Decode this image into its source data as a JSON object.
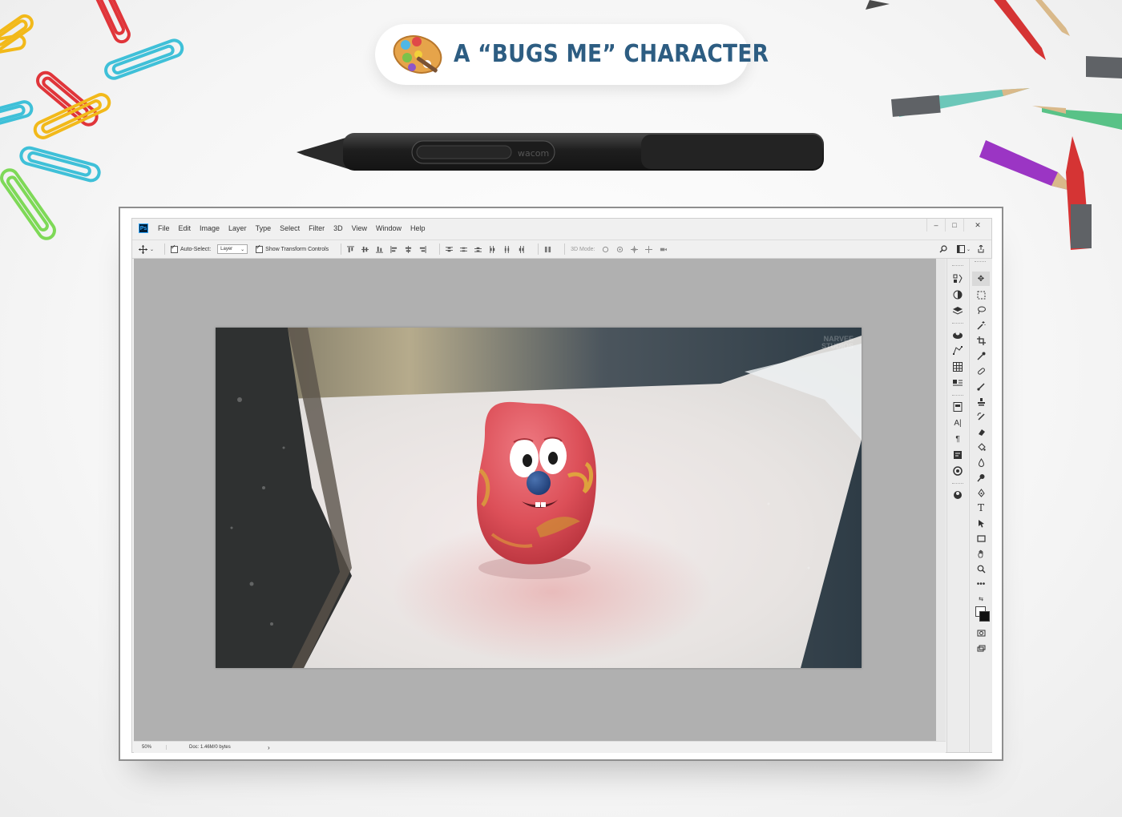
{
  "title": "A “BUGS ME” CHARACTER",
  "pen_brand": "wacom",
  "photoshop": {
    "logo": "Ps",
    "menu": [
      "File",
      "Edit",
      "Image",
      "Layer",
      "Type",
      "Select",
      "Filter",
      "3D",
      "View",
      "Window",
      "Help"
    ],
    "window_controls": {
      "minimize": "–",
      "maximize": "□",
      "close": "✕"
    },
    "options": {
      "auto_select_label": "Auto-Select:",
      "auto_select_value": "Layer",
      "show_transform_label": "Show Transform Controls",
      "mode_3d_label": "3D Mode:"
    },
    "watermark": [
      "NARVEE",
      "STUDIOS"
    ],
    "status": {
      "zoom": "50%",
      "doc": "Doc: 1.46M/0 bytes",
      "arrow": "›"
    },
    "panel_icons": [
      "history-icon",
      "color-icon",
      "layers-icon",
      "3d-icon",
      "paths-icon",
      "swatches-icon",
      "adjustments-icon",
      "properties-icon",
      "character-icon",
      "paragraph-icon",
      "notes-icon",
      "libraries-icon",
      "channels-icon"
    ],
    "tool_icons": [
      "move-tool-icon",
      "marquee-tool-icon",
      "lasso-tool-icon",
      "magic-wand-icon",
      "crop-tool-icon",
      "eyedropper-icon",
      "healing-brush-icon",
      "brush-tool-icon",
      "clone-stamp-icon",
      "history-brush-icon",
      "eraser-icon",
      "paint-bucket-icon",
      "blur-tool-icon",
      "dodge-tool-icon",
      "pen-tool-icon",
      "type-tool-icon",
      "path-selection-icon",
      "rectangle-tool-icon",
      "hand-tool-icon",
      "zoom-tool-icon",
      "more-tools-icon"
    ]
  },
  "colors": {
    "title": "#2d5d82",
    "ps_blue": "#31a8ff",
    "canvas_bg": "#b0b0b0",
    "character": "#e0525a"
  }
}
